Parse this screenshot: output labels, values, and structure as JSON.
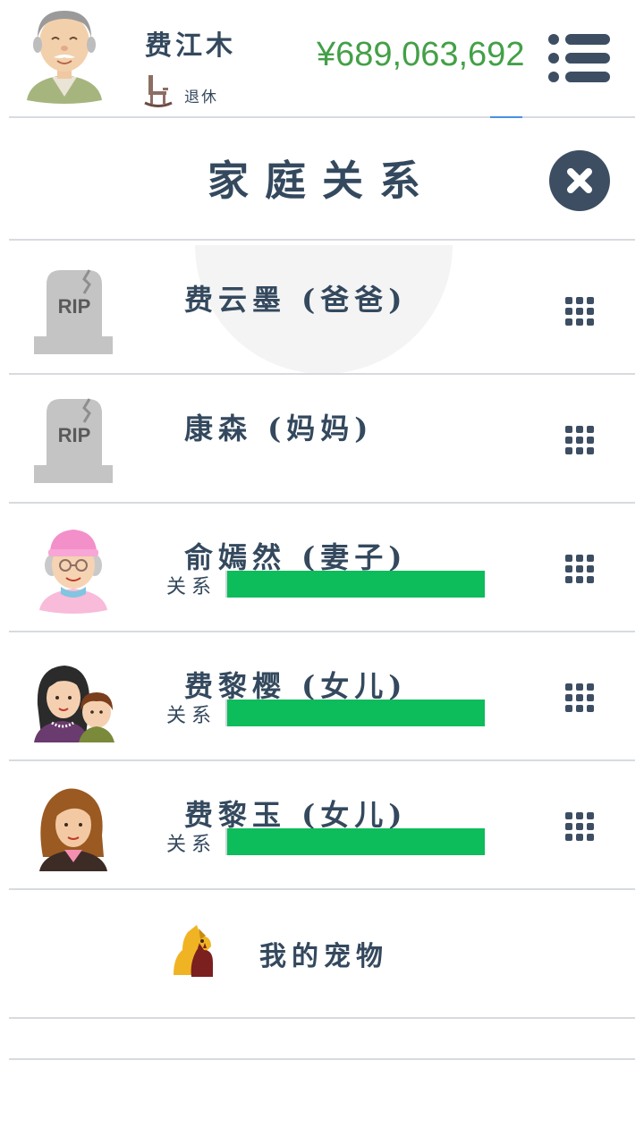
{
  "header": {
    "player_name": "费江木",
    "status": "退休",
    "money": "¥689,063,692"
  },
  "dialog": {
    "title": "家庭关系"
  },
  "relationship_label": "关系",
  "family": [
    {
      "name": "费云墨 (爸爸)",
      "deceased": true,
      "avatar": "tombstone-rip",
      "rip_text": "RIP"
    },
    {
      "name": "康森 (妈妈)",
      "deceased": true,
      "avatar": "tombstone-rip",
      "rip_text": "RIP"
    },
    {
      "name": "俞嫣然 (妻子)",
      "deceased": false,
      "avatar": "elderly-woman",
      "relationship": 1.0
    },
    {
      "name": "费黎樱 (女儿)",
      "deceased": false,
      "avatar": "woman-with-child",
      "relationship": 1.0
    },
    {
      "name": "费黎玉 (女儿)",
      "deceased": false,
      "avatar": "young-woman",
      "relationship": 1.0
    }
  ],
  "pets": {
    "label": "我的宠物",
    "icon": "dog-cat-icon"
  },
  "colors": {
    "text": "#34495e",
    "money": "#43a047",
    "bar": "#0dbc5b",
    "close": "#3d4e63",
    "divider": "#d7dbe0"
  },
  "icons": {
    "menu": "menu-icon",
    "close": "close-icon",
    "options": "grid-menu-icon",
    "status": "rocking-chair-icon"
  }
}
